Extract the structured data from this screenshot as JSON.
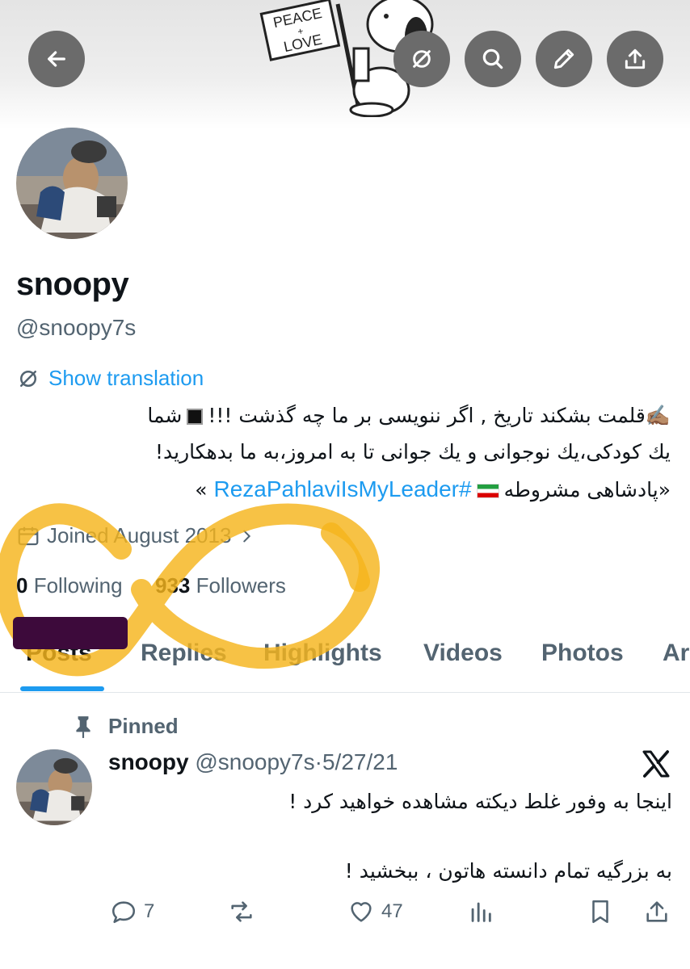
{
  "banner": {
    "sign_line1": "PEACE",
    "sign_line2": "+",
    "sign_line3": "LOVE"
  },
  "header_buttons": {
    "back": "arrow-left-icon",
    "grok": "grok-icon",
    "search": "search-icon",
    "edit": "pencil-icon",
    "share": "share-icon"
  },
  "profile": {
    "display_name": "snoopy",
    "handle": "@snoopy7s",
    "show_translation": "Show translation",
    "bio": {
      "line1": "✍🏽قلمت بشکند تاریخ , اگر ننویسی بر ما چه گذشت !!!",
      "line1_end": "شما",
      "line2": "يك كودكى،يك نوجوانى و يك جوانى تا به امروز،به ما بدهكاريد!",
      "line3_text": "«پادشاهی مشروطه",
      "hashtag": "#RezaPahlaviIsMyLeader",
      "line3_end": "»"
    },
    "joined": "Joined August 2013",
    "following_count": "0",
    "following_label": "Following",
    "followers_count": "933",
    "followers_label": "Followers"
  },
  "tabs": [
    "Posts",
    "Replies",
    "Highlights",
    "Videos",
    "Photos",
    "Ar"
  ],
  "active_tab": "Posts",
  "pinned_post": {
    "pinned_label": "Pinned",
    "author_name": "snoopy",
    "author_handle": "@snoopy7s",
    "separator": "·",
    "date": "5/27/21",
    "text_line1": "اینجا به وفور غلط دیکته مشاهده خواهید کرد !",
    "text_line2": "به بزرگیه تمام دانسته هاتون ، ببخشید !",
    "replies": "7",
    "likes": "47"
  },
  "colors": {
    "accent": "#1d9bf0",
    "muted": "#536471",
    "text": "#0f1419",
    "highlight_marker": "#f5b51c",
    "redaction": "#3d0a3b"
  }
}
